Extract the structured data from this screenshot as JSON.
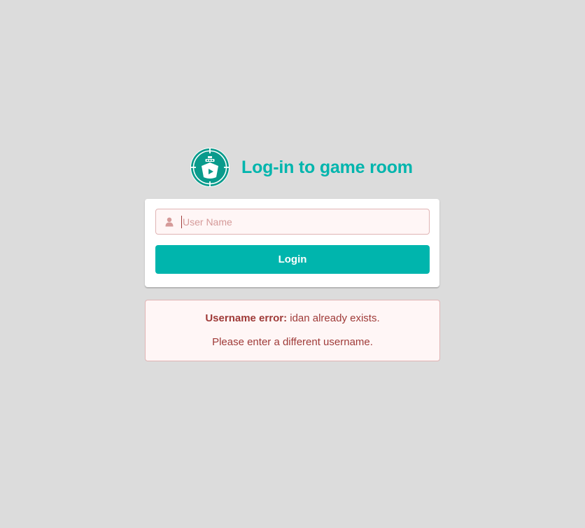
{
  "header": {
    "title": "Log-in to game room",
    "logo_icon": "ship-crosshair-icon"
  },
  "form": {
    "username": {
      "placeholder": "User Name",
      "value": "",
      "icon": "user-icon"
    },
    "login_label": "Login"
  },
  "error": {
    "heading": "Username error:",
    "message": "idan already exists.",
    "hint": "Please enter a different username."
  },
  "colors": {
    "accent": "#00b5ad",
    "background": "#dcdcdc",
    "error_text": "#9f3a38",
    "error_bg": "#fff6f6",
    "error_border": "#e0b4b4"
  }
}
